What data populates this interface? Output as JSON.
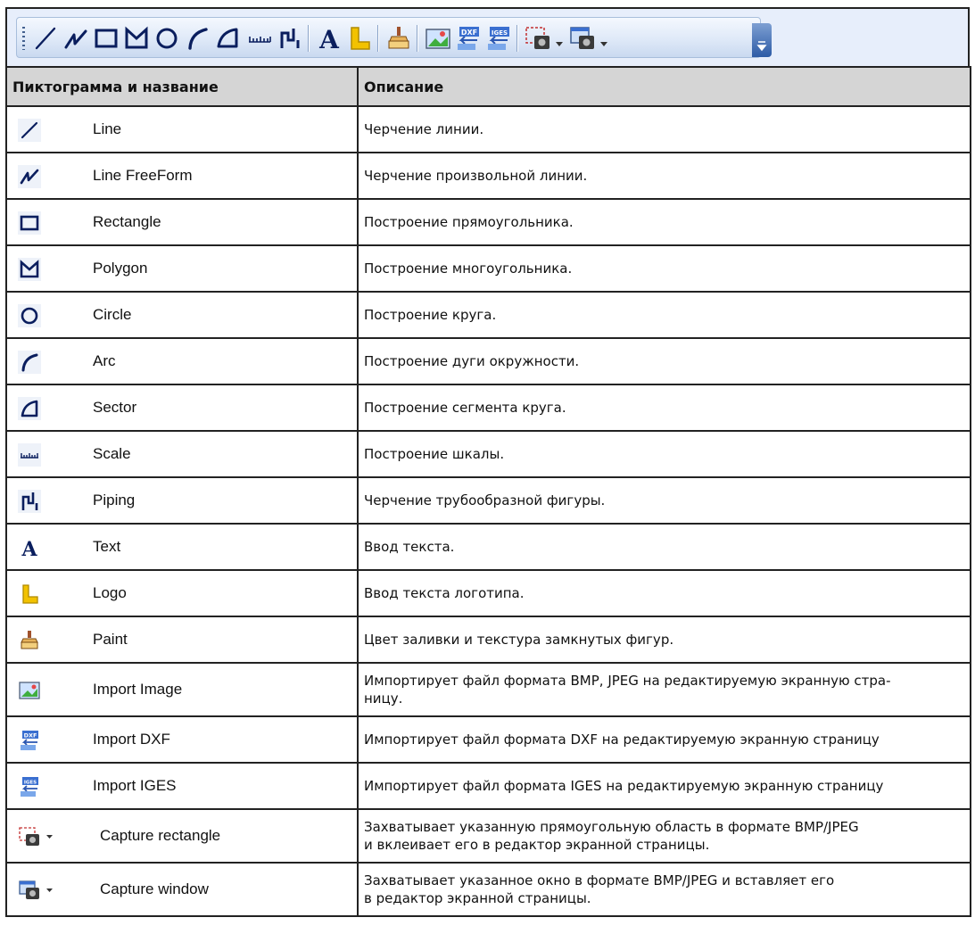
{
  "toolbar": {
    "buttons": [
      {
        "name": "line-icon"
      },
      {
        "name": "line-freeform-icon"
      },
      {
        "name": "rectangle-icon"
      },
      {
        "name": "polygon-icon"
      },
      {
        "name": "circle-icon"
      },
      {
        "name": "arc-icon"
      },
      {
        "name": "sector-icon"
      },
      {
        "name": "scale-icon"
      },
      {
        "name": "piping-icon"
      },
      {
        "name": "text-icon"
      },
      {
        "name": "logo-icon"
      },
      {
        "name": "paint-icon"
      },
      {
        "name": "import-image-icon"
      },
      {
        "name": "import-dxf-icon"
      },
      {
        "name": "import-iges-icon"
      },
      {
        "name": "capture-rectangle-icon"
      },
      {
        "name": "capture-window-icon"
      }
    ]
  },
  "table": {
    "headers": {
      "icon_and_name": "Пиктограмма и название",
      "description": "Описание"
    },
    "rows": [
      {
        "name": "Line",
        "description": "Черчение линии.",
        "icon": "line-icon"
      },
      {
        "name": "Line FreeForm",
        "description": "Черчение произвольной линии.",
        "icon": "line-freeform-icon"
      },
      {
        "name": "Rectangle",
        "description": "Построение прямоугольника.",
        "icon": "rectangle-icon"
      },
      {
        "name": "Polygon",
        "description": "Построение многоугольника.",
        "icon": "polygon-icon"
      },
      {
        "name": "Circle",
        "description": "Построение круга.",
        "icon": "circle-icon"
      },
      {
        "name": "Arc",
        "description": "Построение дуги окружности.",
        "icon": "arc-icon"
      },
      {
        "name": "Sector",
        "description": "Построение сегмента круга.",
        "icon": "sector-icon"
      },
      {
        "name": "Scale",
        "description": "Построение шкалы.",
        "icon": "scale-icon"
      },
      {
        "name": "Piping",
        "description": "Черчение трубообразной фигуры.",
        "icon": "piping-icon"
      },
      {
        "name": "Text",
        "description": "Ввод текста.",
        "icon": "text-icon"
      },
      {
        "name": "Logo",
        "description": "Ввод текста логотипа.",
        "icon": "logo-icon"
      },
      {
        "name": "Paint",
        "description": "Цвет заливки и текстура замкнутых фигур.",
        "icon": "paint-icon"
      },
      {
        "name": "Import Image",
        "description": "Импортирует файл формата BMP, JPEG на редактируемую экранную стра-",
        "description_2": "ницу.",
        "icon": "import-image-icon"
      },
      {
        "name": "Import DXF",
        "description": "Импортирует файл формата DXF на редактируемую экранную страницу",
        "icon": "import-dxf-icon"
      },
      {
        "name": "Import IGES",
        "description": "Импортирует файл формата IGES на редактируемую экранную страницу",
        "icon": "import-iges-icon"
      },
      {
        "name": "Capture rectangle",
        "description": "Захватывает указанную прямоугольную область в формате BMP/JPEG",
        "description_2": "и вклеивает его в редактор экранной страницы.",
        "icon": "capture-rectangle-icon"
      },
      {
        "name": "Capture window",
        "description": "Захватывает указанное окно в формате BMP/JPEG и вставляет его",
        "description_2": "в редактор экранной страницы.",
        "icon": "capture-window-icon"
      }
    ]
  },
  "colors": {
    "header_bg": "#d5d5d5",
    "toolbar_bg": "#dfe9f8",
    "icon_dark_blue": "#0a1e5e",
    "logo_yellow": "#f2c200"
  }
}
